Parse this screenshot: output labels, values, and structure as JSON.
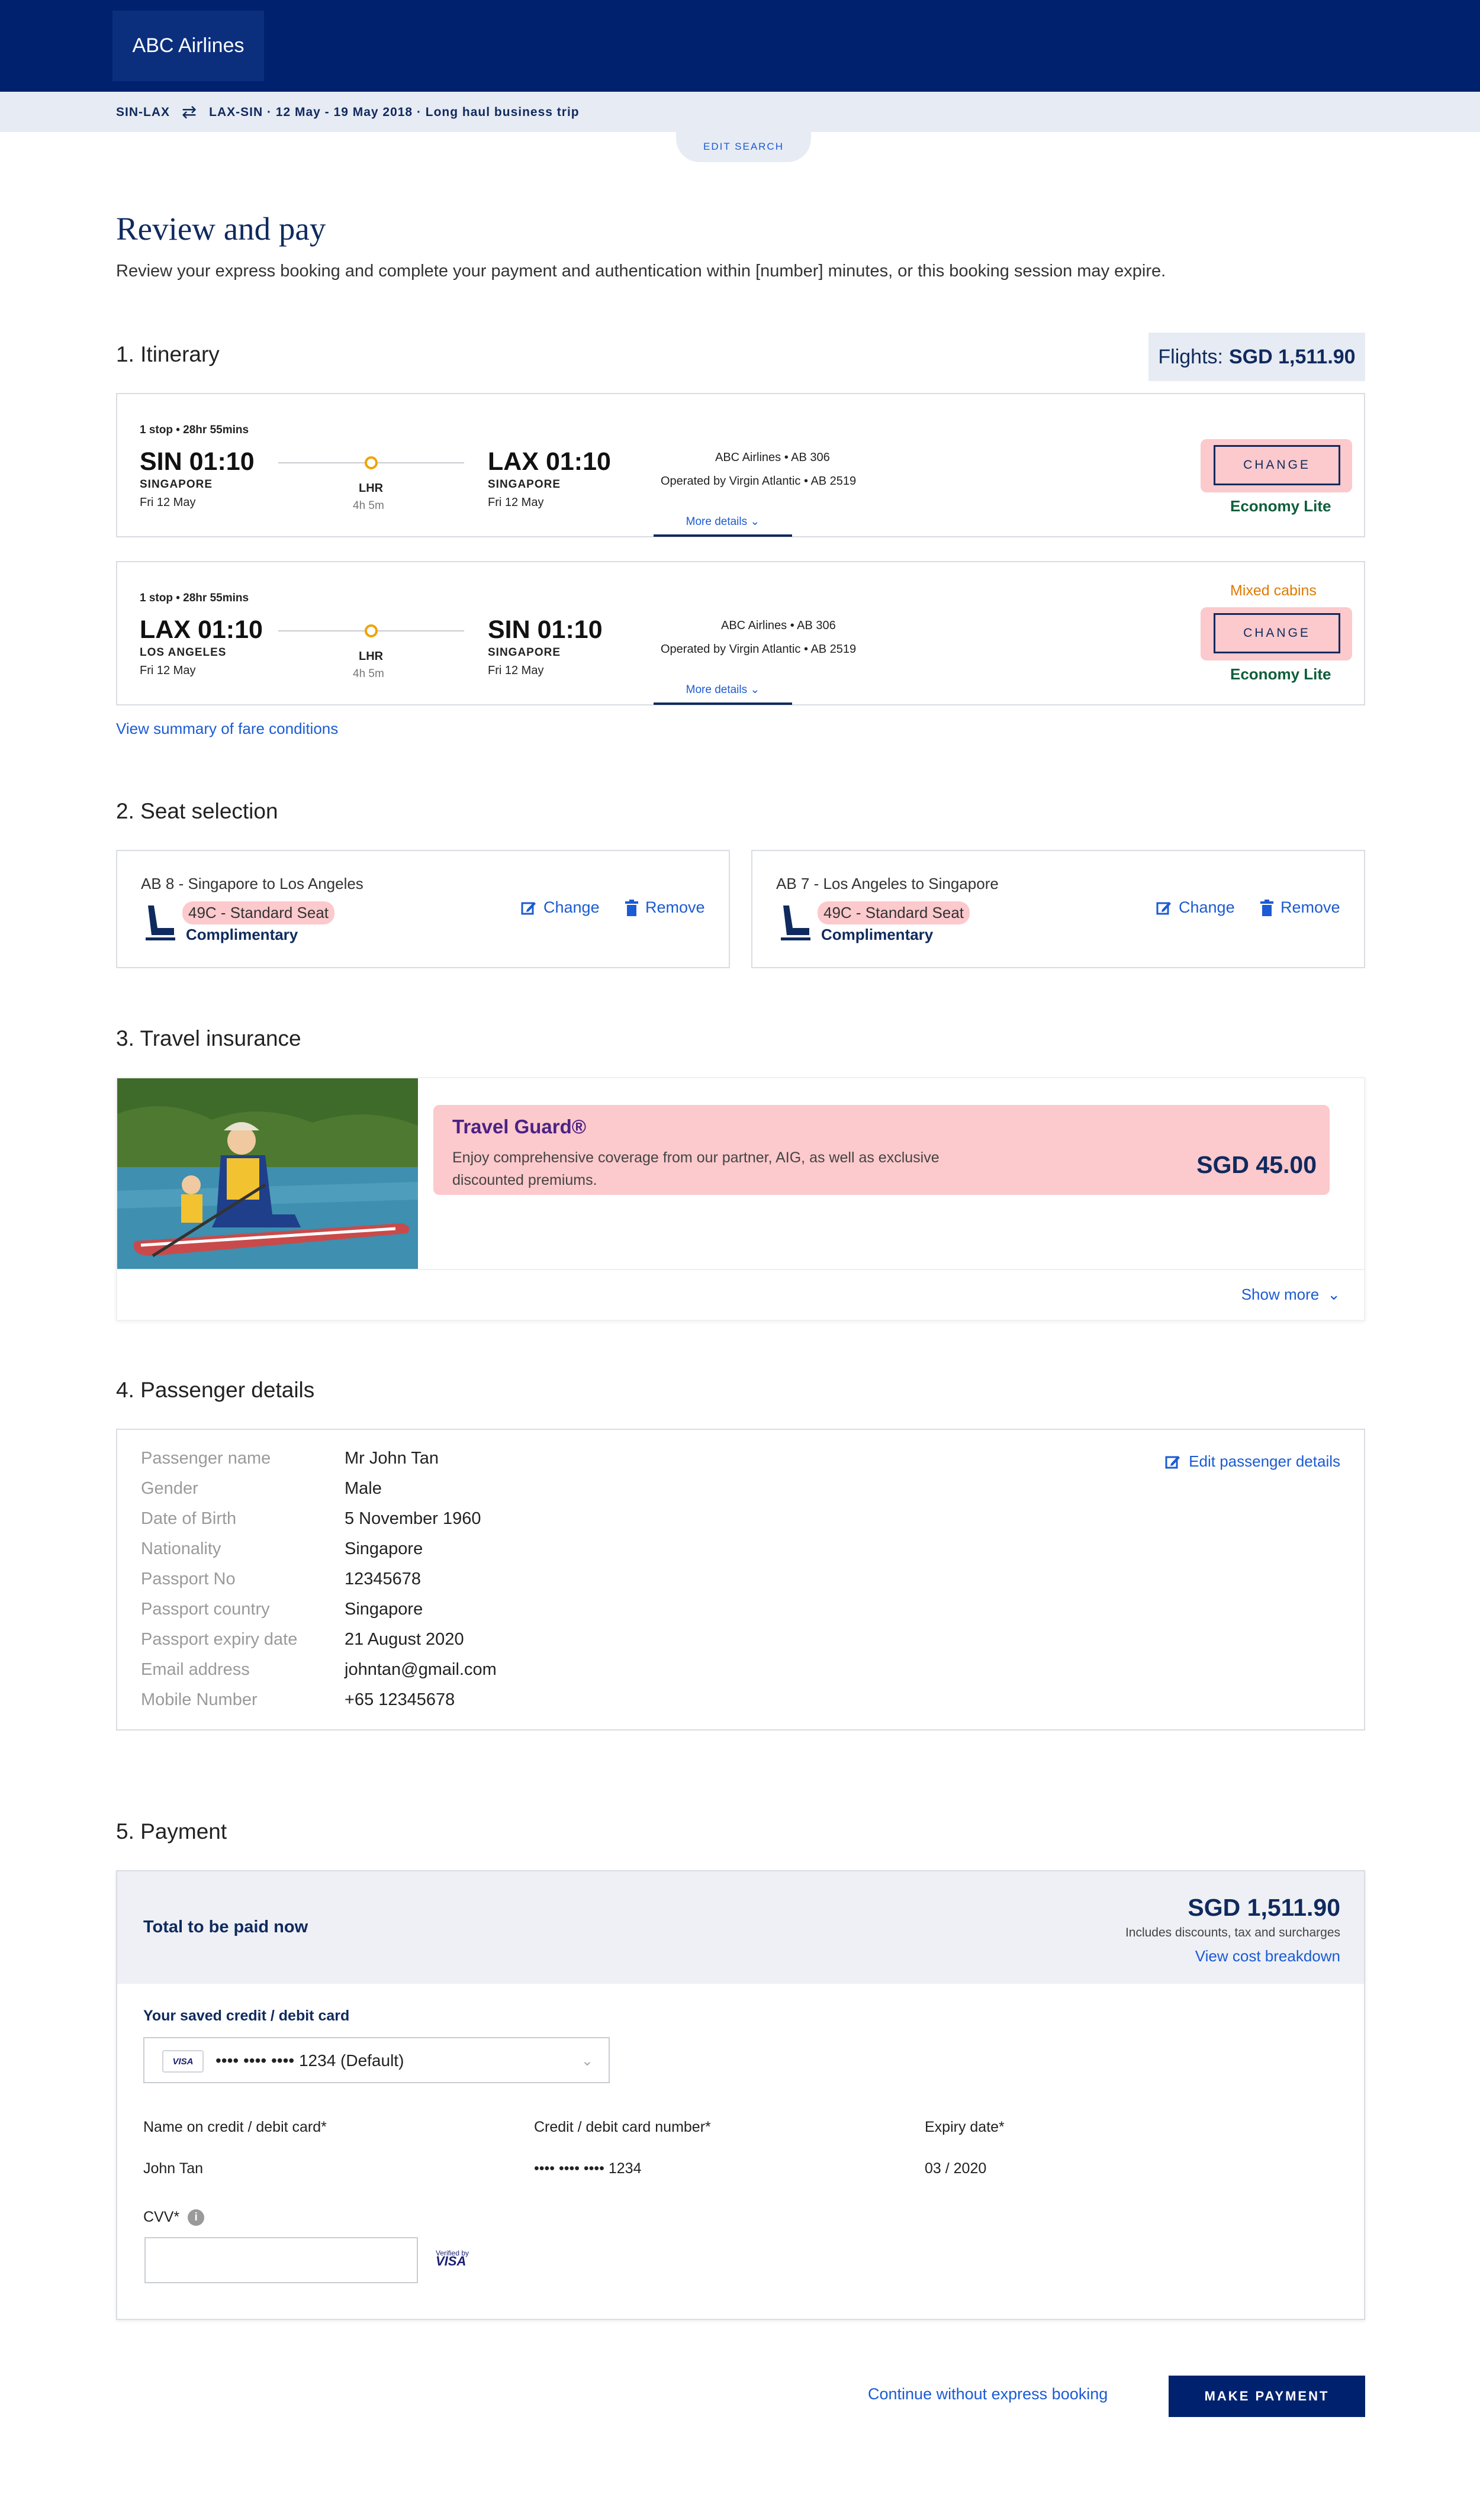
{
  "header": {
    "logo": "ABC Airlines",
    "route_outbound": "SIN-LAX",
    "route_details": "LAX-SIN · 12 May - 19 May 2018 · Long haul business trip",
    "edit_search": "EDIT SEARCH"
  },
  "page": {
    "title": "Review and pay",
    "subtitle": "Review your express booking and complete your payment and authentication within [number] minutes, or this booking session may expire."
  },
  "itinerary": {
    "heading": "1. Itinerary",
    "flights_label": "Flights:",
    "flights_total": "SGD 1,511.90",
    "fare_conditions_link": "View summary of fare conditions",
    "flights": [
      {
        "stops": "1 stop • 28hr 55mins",
        "dep_time": "SIN 01:10",
        "dep_city": "SINGAPORE",
        "dep_date": "Fri 12 May",
        "stop_code": "LHR",
        "stop_duration": "4h 5m",
        "arr_time": "LAX 01:10",
        "arr_city": "SINGAPORE",
        "arr_date": "Fri 12 May",
        "airline": "ABC  Airlines • AB 306",
        "operated": "Operated by Virgin Atlantic • AB 2519",
        "more_details": "More details",
        "change": "CHANGE",
        "fare": "Economy Lite",
        "note": ""
      },
      {
        "stops": "1 stop • 28hr 55mins",
        "dep_time": "LAX 01:10",
        "dep_city": "LOS ANGELES",
        "dep_date": "Fri 12 May",
        "stop_code": "LHR",
        "stop_duration": "4h 5m",
        "arr_time": "SIN 01:10",
        "arr_city": "SINGAPORE",
        "arr_date": "Fri 12 May",
        "airline": "ABC Airlines • AB 306",
        "operated": "Operated by Virgin Atlantic • AB 2519",
        "more_details": "More details",
        "change": "CHANGE",
        "fare": "Economy Lite",
        "note": "Mixed cabins"
      }
    ]
  },
  "seats": {
    "heading": "2. Seat selection",
    "items": [
      {
        "route": "AB 8 - Singapore to Los Angeles",
        "seat": "49C - Standard Seat",
        "price": "Complimentary",
        "change": "Change",
        "remove": "Remove"
      },
      {
        "route": "AB 7 - Los Angeles to Singapore",
        "seat": "49C - Standard Seat",
        "price": "Complimentary",
        "change": "Change",
        "remove": "Remove"
      }
    ]
  },
  "insurance": {
    "heading": "3. Travel insurance",
    "name": "Travel Guard®",
    "description": "Enjoy comprehensive coverage from our partner, AIG, as well as exclusive discounted premiums.",
    "price": "SGD 45.00",
    "show_more": "Show more"
  },
  "passenger": {
    "heading": "4. Passenger details",
    "edit": "Edit passenger details",
    "fields": [
      {
        "label": "Passenger name",
        "value": "Mr John Tan"
      },
      {
        "label": "Gender",
        "value": "Male"
      },
      {
        "label": "Date of Birth",
        "value": "5 November 1960"
      },
      {
        "label": "Nationality",
        "value": "Singapore"
      },
      {
        "label": "Passport No",
        "value": "12345678"
      },
      {
        "label": "Passport country",
        "value": "Singapore"
      },
      {
        "label": "Passport expiry date",
        "value": "21 August 2020"
      },
      {
        "label": "Email address",
        "value": "johntan@gmail.com"
      },
      {
        "label": "Mobile Number",
        "value": "+65 12345678"
      }
    ]
  },
  "payment": {
    "heading": "5. Payment",
    "total_label": "Total to be paid now",
    "total": "SGD 1,511.90",
    "total_note": "Includes discounts, tax and surcharges",
    "breakdown": "View cost breakdown",
    "saved_card_label": "Your saved credit / debit card",
    "card_brand": "VISA",
    "saved_card": "•••• •••• •••• 1234 (Default)",
    "name_label": "Name on credit / debit card*",
    "name_value": "John Tan",
    "number_label": "Credit / debit card number*",
    "number_value": "•••• •••• •••• 1234",
    "expiry_label": "Expiry date*",
    "expiry_value": "03 / 2020",
    "cvv_label": "CVV*",
    "cvv_value": "",
    "verified_by": "Verified by",
    "verified_brand": "VISA"
  },
  "footer": {
    "continue": "Continue without express booking",
    "make_payment": "MAKE PAYMENT"
  },
  "colors": {
    "brand_navy": "#00226e",
    "link_blue": "#1b5bd3",
    "highlight_pink": "#fcc9cc",
    "fare_green": "#0e5e3b",
    "mixed_orange": "#e07a00"
  }
}
